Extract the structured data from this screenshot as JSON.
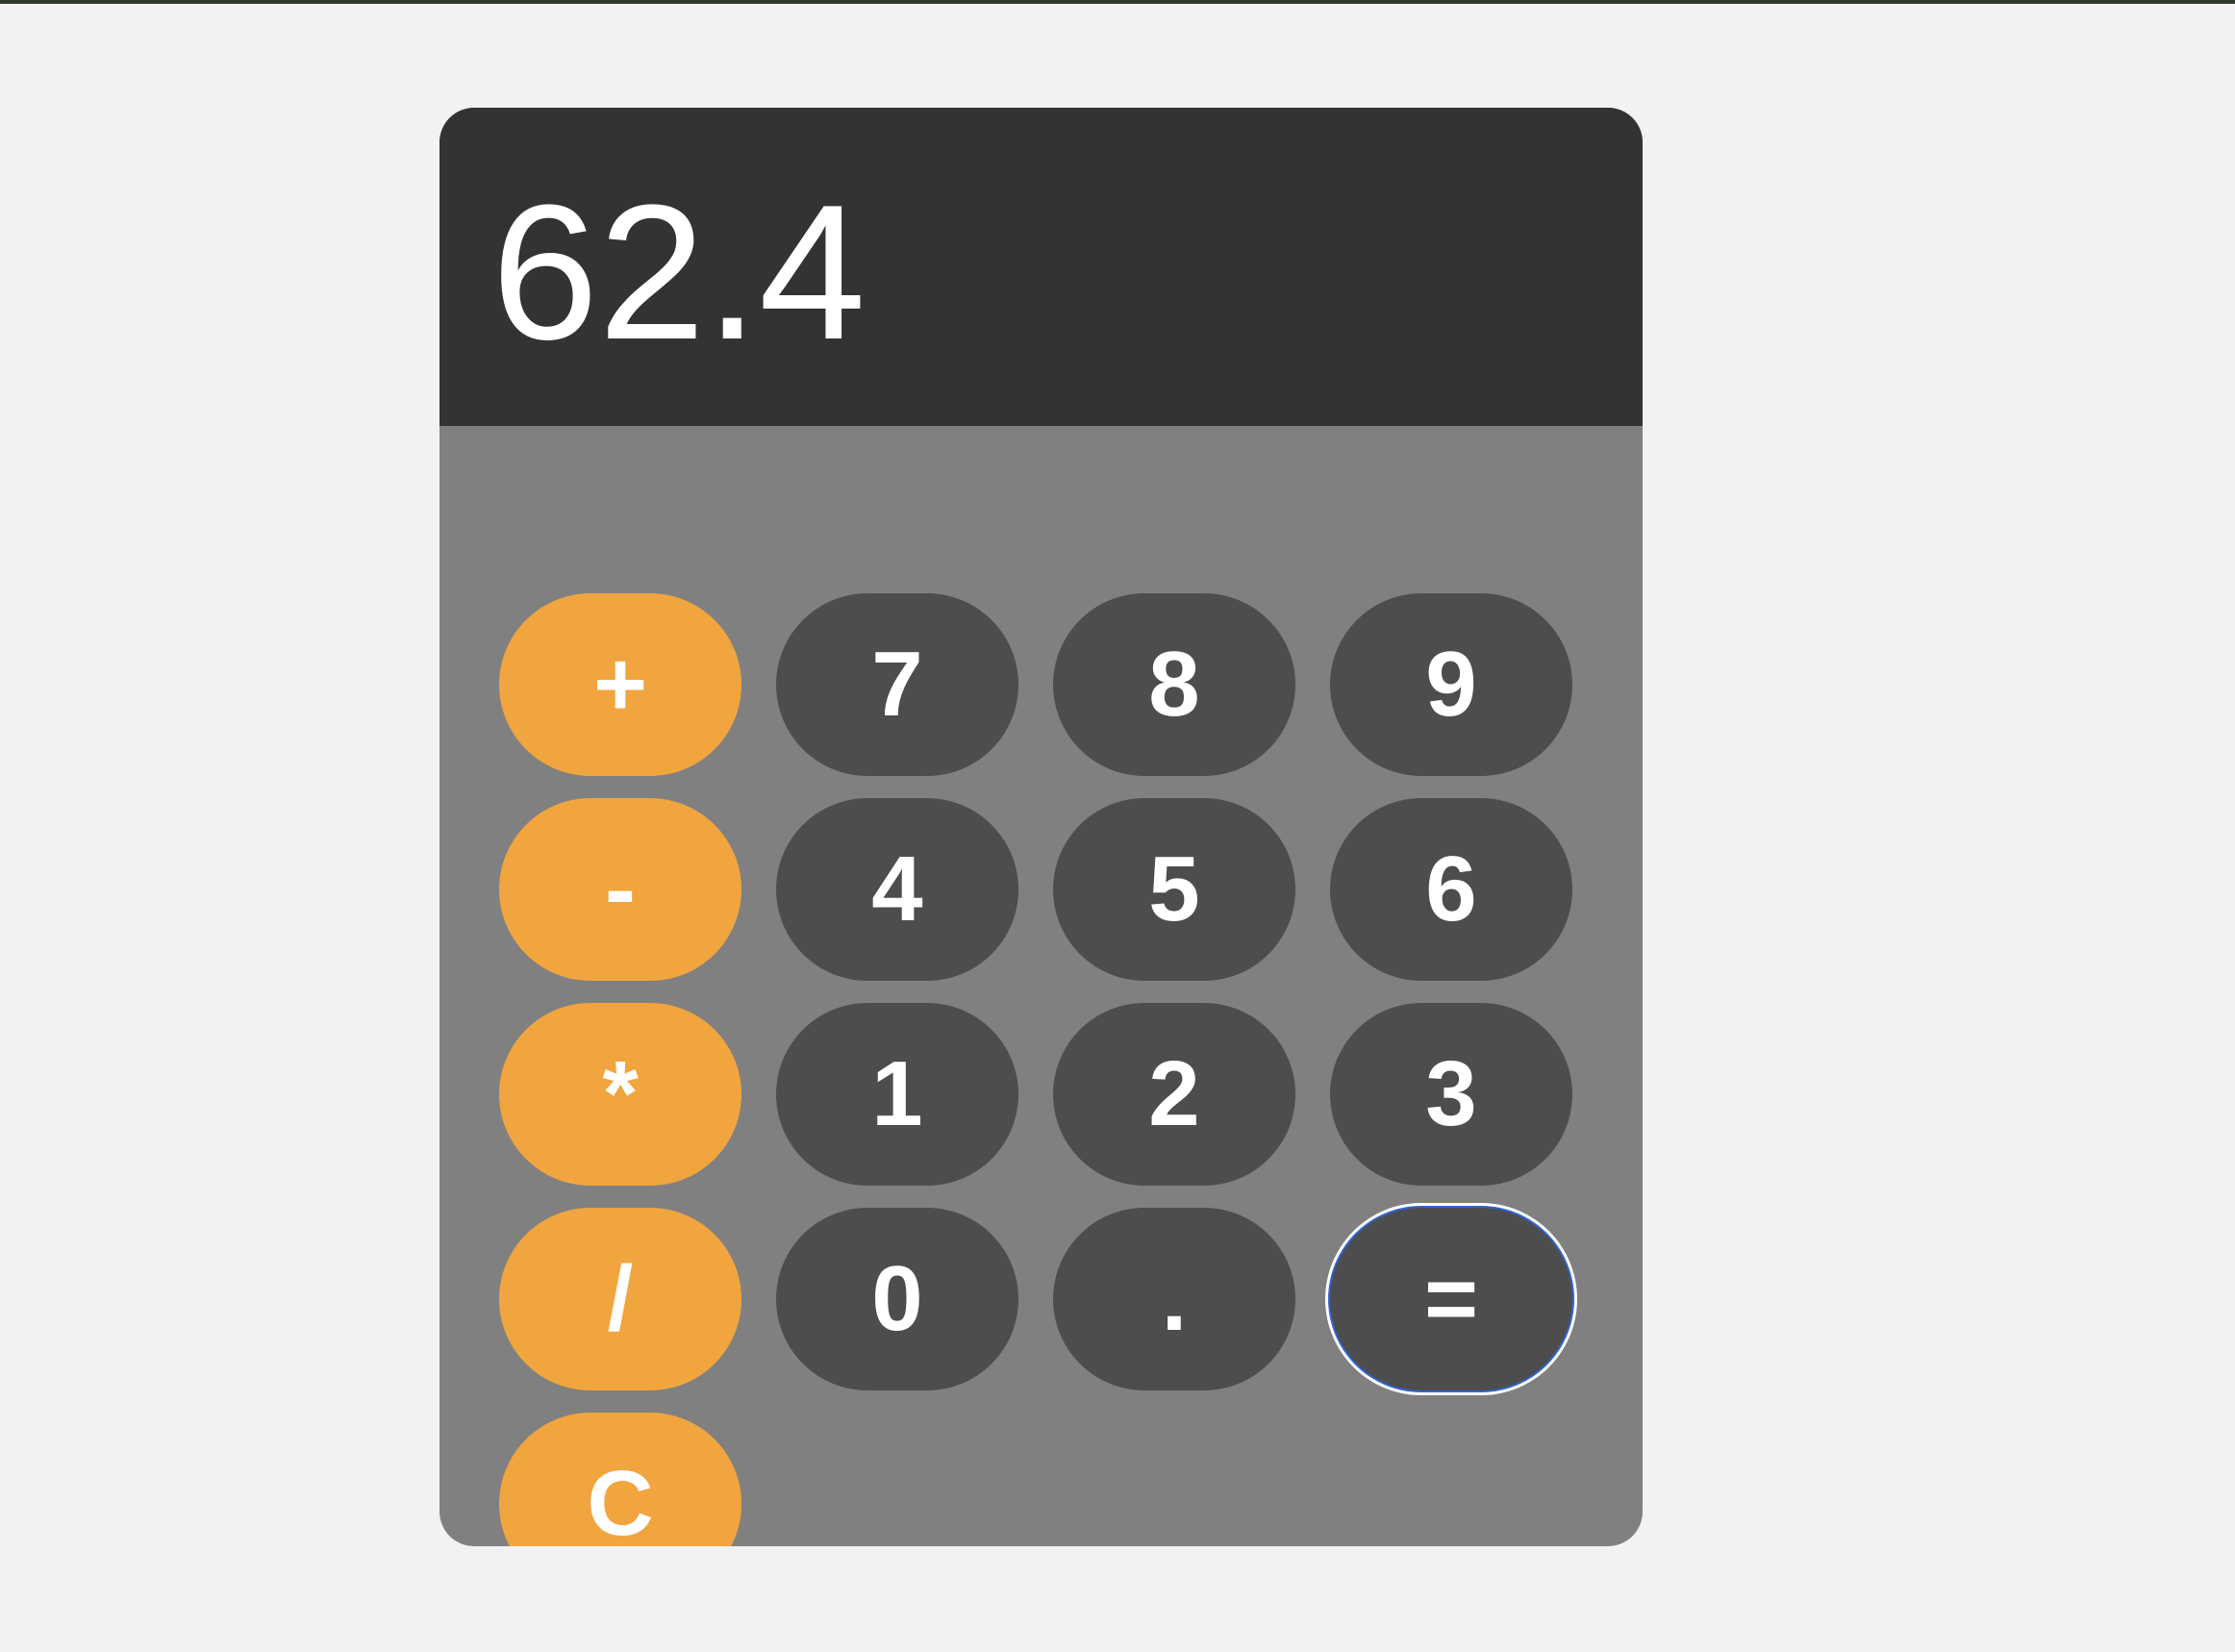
{
  "display": {
    "value": "62.4"
  },
  "keypad": {
    "rows": [
      [
        {
          "label": "+",
          "name": "plus-button",
          "kind": "op"
        },
        {
          "label": "7",
          "name": "digit-7-button",
          "kind": "num"
        },
        {
          "label": "8",
          "name": "digit-8-button",
          "kind": "num"
        },
        {
          "label": "9",
          "name": "digit-9-button",
          "kind": "num"
        }
      ],
      [
        {
          "label": "-",
          "name": "minus-button",
          "kind": "op"
        },
        {
          "label": "4",
          "name": "digit-4-button",
          "kind": "num"
        },
        {
          "label": "5",
          "name": "digit-5-button",
          "kind": "num"
        },
        {
          "label": "6",
          "name": "digit-6-button",
          "kind": "num"
        }
      ],
      [
        {
          "label": "*",
          "name": "multiply-button",
          "kind": "op"
        },
        {
          "label": "1",
          "name": "digit-1-button",
          "kind": "num"
        },
        {
          "label": "2",
          "name": "digit-2-button",
          "kind": "num"
        },
        {
          "label": "3",
          "name": "digit-3-button",
          "kind": "num"
        }
      ],
      [
        {
          "label": "/",
          "name": "divide-button",
          "kind": "op"
        },
        {
          "label": "0",
          "name": "digit-0-button",
          "kind": "num"
        },
        {
          "label": ".",
          "name": "decimal-button",
          "kind": "num"
        },
        {
          "label": "=",
          "name": "equals-button",
          "kind": "num",
          "focused": true
        }
      ],
      [
        {
          "label": "C",
          "name": "clear-button",
          "kind": "op"
        }
      ]
    ]
  },
  "colors": {
    "page_background": "#f2f2f2",
    "display_background": "#333333",
    "keypad_background": "#808080",
    "operator_key": "#f1a53f",
    "number_key": "#4d4d4d",
    "key_text": "#ffffff",
    "focus_ring": "#2f63cf"
  }
}
